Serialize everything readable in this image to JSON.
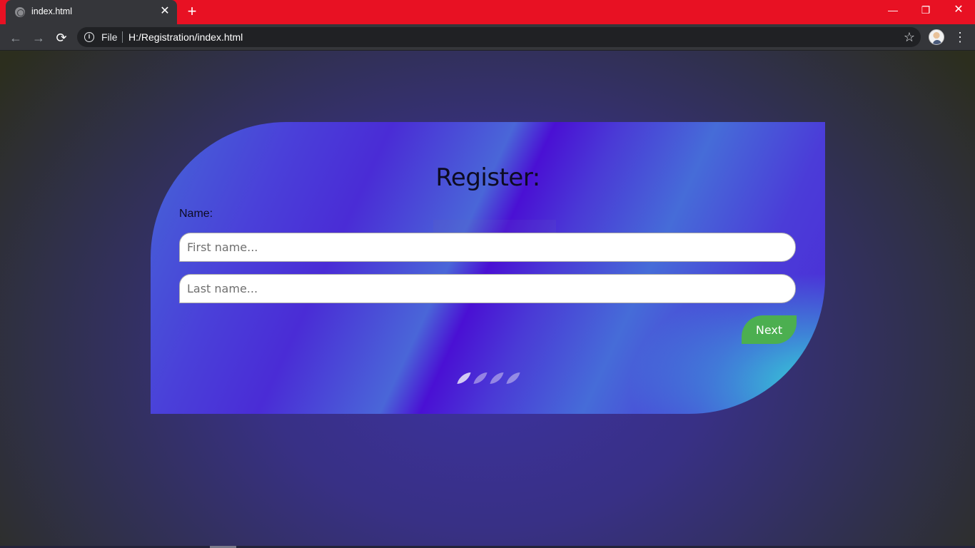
{
  "browser": {
    "tab_title": "index.html",
    "tab_close": "✕",
    "new_tab": "+",
    "window_controls": {
      "minimize": "—",
      "maximize": "❐",
      "close": "✕"
    },
    "nav": {
      "back": "←",
      "forward": "→",
      "reload": "⟳"
    },
    "omnibox": {
      "info": "i",
      "scheme": "File",
      "url": "H:/Registration/index.html"
    },
    "star": "☆",
    "menu": "⋮",
    "colors": {
      "titlebar": "#e81123",
      "toolbar": "#35363a",
      "omnibox": "#202124"
    }
  },
  "page": {
    "form_title": "Register:",
    "name_label": "Name:",
    "first_name_placeholder": "First name...",
    "last_name_placeholder": "Last name...",
    "next_label": "Next",
    "step_count": 4,
    "active_step": 1,
    "colors": {
      "next_button": "#4caf50",
      "card_primary": "#4a2cd6",
      "card_accent": "#34dcd7"
    }
  },
  "icons": {
    "tab_favicon": "globe-icon",
    "info": "info-icon",
    "star": "star-icon",
    "menu": "kebab-menu-icon",
    "profile": "avatar"
  }
}
